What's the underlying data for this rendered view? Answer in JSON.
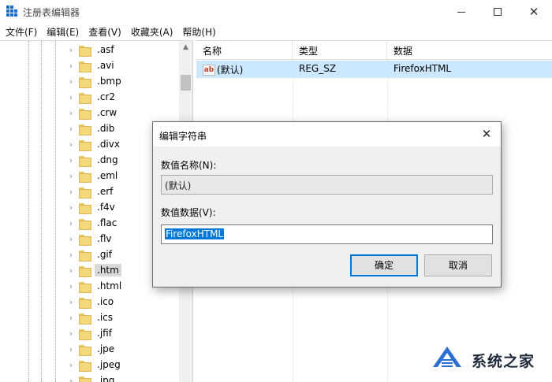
{
  "window": {
    "title": "注册表编辑器",
    "icon": "registry-editor-icon",
    "accent": "#0078d7"
  },
  "menu": [
    "文件(F)",
    "编辑(E)",
    "查看(V)",
    "收藏夹(A)",
    "帮助(H)"
  ],
  "tree": {
    "items": [
      ".asf",
      ".avi",
      ".bmp",
      ".cr2",
      ".crw",
      ".dib",
      ".divx",
      ".dng",
      ".eml",
      ".erf",
      ".f4v",
      ".flac",
      ".flv",
      ".gif",
      ".htm",
      ".html",
      ".ico",
      ".ics",
      ".jfif",
      ".jpe",
      ".jpeg",
      ".jpg"
    ],
    "selected": ".htm"
  },
  "list": {
    "columns": [
      "名称",
      "类型",
      "数据"
    ],
    "rows": [
      {
        "name": "(默认)",
        "type": "REG_SZ",
        "data": "FirefoxHTML",
        "icon": "ab-string-icon"
      }
    ],
    "selected_row_color": "#cce8ff"
  },
  "dialog": {
    "title": "编辑字符串",
    "value_name_label": "数值名称(N):",
    "value_name": "(默认)",
    "value_data_label": "数值数据(V):",
    "value_data": "FirefoxHTML",
    "ok_label": "确定",
    "cancel_label": "取消"
  },
  "watermark": {
    "text": "系统之家"
  }
}
